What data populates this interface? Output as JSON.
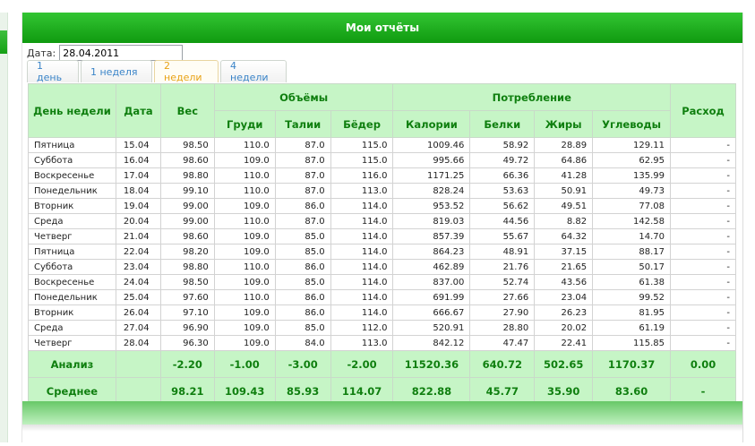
{
  "header": {
    "title": "Мои отчёты"
  },
  "date_filter": {
    "label": "Дата:",
    "value": "28.04.2011"
  },
  "tabs": [
    {
      "label": "1 день",
      "active": false
    },
    {
      "label": "1 неделя",
      "active": false
    },
    {
      "label": "2 недели",
      "active": true
    },
    {
      "label": "4 недели",
      "active": false
    }
  ],
  "table": {
    "headers": {
      "day": "День недели",
      "date": "Дата",
      "weight": "Вес",
      "volumes": "Объёмы",
      "chest": "Груди",
      "waist": "Талии",
      "hips": "Бёдер",
      "consumption": "Потребление",
      "calories": "Калории",
      "proteins": "Белки",
      "fats": "Жиры",
      "carbs": "Углеводы",
      "expense": "Расход"
    },
    "rows": [
      [
        "Пятница",
        "15.04",
        "98.50",
        "110.0",
        "87.0",
        "115.0",
        "1009.46",
        "58.92",
        "28.89",
        "129.11",
        "-"
      ],
      [
        "Суббота",
        "16.04",
        "98.60",
        "109.0",
        "87.0",
        "115.0",
        "995.66",
        "49.72",
        "64.86",
        "62.95",
        "-"
      ],
      [
        "Воскресенье",
        "17.04",
        "98.80",
        "110.0",
        "87.0",
        "116.0",
        "1171.25",
        "66.36",
        "41.28",
        "135.99",
        "-"
      ],
      [
        "Понедельник",
        "18.04",
        "99.10",
        "110.0",
        "87.0",
        "113.0",
        "828.24",
        "53.63",
        "50.91",
        "49.73",
        "-"
      ],
      [
        "Вторник",
        "19.04",
        "99.00",
        "109.0",
        "86.0",
        "114.0",
        "953.52",
        "56.62",
        "49.51",
        "77.08",
        "-"
      ],
      [
        "Среда",
        "20.04",
        "99.00",
        "110.0",
        "87.0",
        "114.0",
        "819.03",
        "44.56",
        "8.82",
        "142.58",
        "-"
      ],
      [
        "Четверг",
        "21.04",
        "98.60",
        "109.0",
        "85.0",
        "114.0",
        "857.39",
        "55.67",
        "64.32",
        "14.70",
        "-"
      ],
      [
        "Пятница",
        "22.04",
        "98.20",
        "109.0",
        "85.0",
        "114.0",
        "864.23",
        "48.91",
        "37.15",
        "88.17",
        "-"
      ],
      [
        "Суббота",
        "23.04",
        "98.80",
        "110.0",
        "86.0",
        "114.0",
        "462.89",
        "21.76",
        "21.65",
        "50.17",
        "-"
      ],
      [
        "Воскресенье",
        "24.04",
        "98.50",
        "109.0",
        "85.0",
        "114.0",
        "837.00",
        "52.74",
        "43.56",
        "61.38",
        "-"
      ],
      [
        "Понедельник",
        "25.04",
        "97.60",
        "110.0",
        "86.0",
        "114.0",
        "691.99",
        "27.66",
        "23.04",
        "99.52",
        "-"
      ],
      [
        "Вторник",
        "26.04",
        "97.10",
        "109.0",
        "86.0",
        "114.0",
        "666.67",
        "27.90",
        "26.23",
        "81.95",
        "-"
      ],
      [
        "Среда",
        "27.04",
        "96.90",
        "109.0",
        "85.0",
        "112.0",
        "520.91",
        "28.80",
        "20.02",
        "61.19",
        "-"
      ],
      [
        "Четверг",
        "28.04",
        "96.30",
        "109.0",
        "84.0",
        "113.0",
        "842.12",
        "47.47",
        "22.41",
        "115.85",
        "-"
      ]
    ],
    "analysis": {
      "label": "Анализ",
      "date": "",
      "weight": "-2.20",
      "chest": "-1.00",
      "waist": "-3.00",
      "hips": "-2.00",
      "calories": "11520.36",
      "proteins": "640.72",
      "fats": "502.65",
      "carbs": "1170.37",
      "expense": "0.00"
    },
    "average": {
      "label": "Среднее",
      "date": "",
      "weight": "98.21",
      "chest": "109.43",
      "waist": "85.93",
      "hips": "114.07",
      "calories": "822.88",
      "proteins": "45.77",
      "fats": "35.90",
      "carbs": "83.60",
      "expense": "-"
    }
  },
  "colors": {
    "header_green": "#15a015",
    "table_header_bg": "#c6f5c6",
    "table_header_text": "#0f7f0f",
    "active_tab_text": "#e8a215",
    "tab_text": "#3a84c8"
  }
}
